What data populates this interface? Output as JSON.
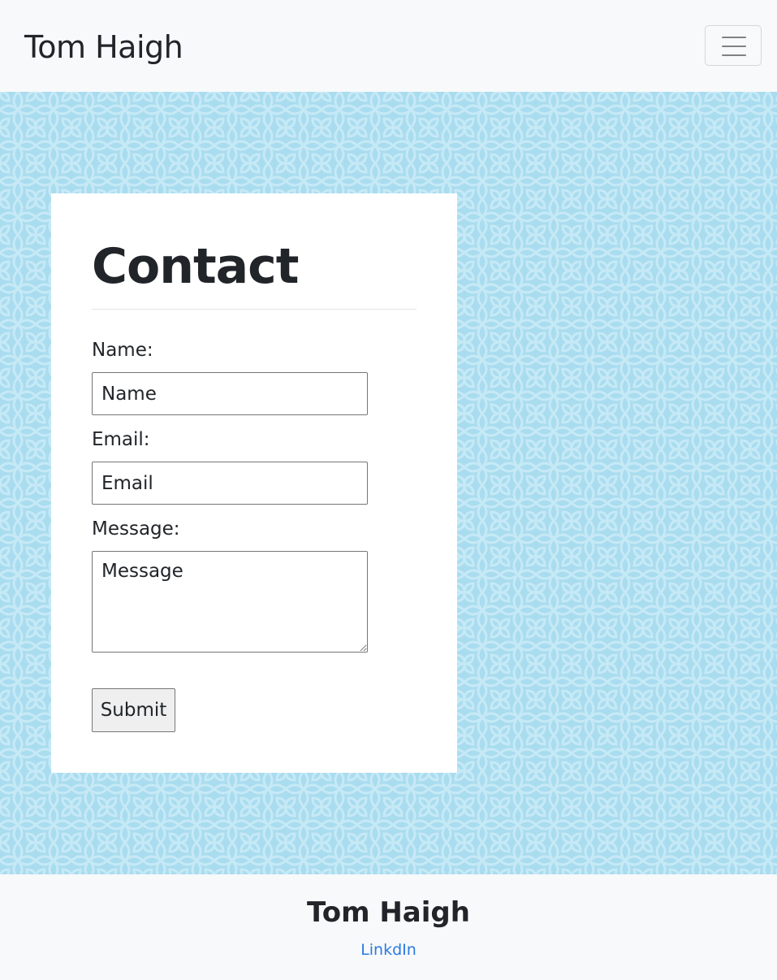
{
  "navbar": {
    "brand": "Tom Haigh",
    "toggle_icon": "hamburger-menu-icon"
  },
  "hero": {
    "background_color": "#a9dcef",
    "pattern_color": "#c6e9f6"
  },
  "contact": {
    "title": "Contact",
    "name_label": "Name:",
    "name_placeholder": "Name",
    "email_label": "Email:",
    "email_placeholder": "Email",
    "message_label": "Message:",
    "message_placeholder": "Message",
    "submit_label": "Submit"
  },
  "footer": {
    "name": "Tom Haigh",
    "link_label": "LinkdIn",
    "link_color": "#2a7ae2"
  }
}
